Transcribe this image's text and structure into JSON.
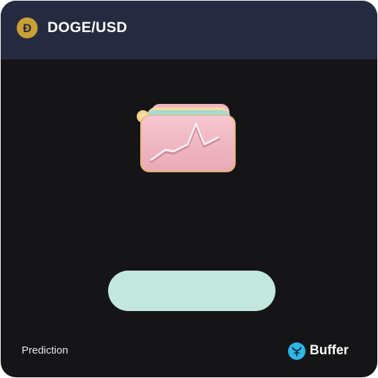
{
  "header": {
    "pair": "DOGE/USD",
    "coin_icon": "dogecoin-icon",
    "coin_color": "#c8a033"
  },
  "illustration": {
    "icon": "stacked-chart-cards-illustration",
    "card_color": "#f0b8c4"
  },
  "action": {
    "button_label": "",
    "button_color": "#c2e7df"
  },
  "footer": {
    "label": "Prediction",
    "brand_name": "Buffer",
    "brand_icon": "buffer-logo-icon",
    "brand_color": "#2fb6e6"
  },
  "colors": {
    "card_background": "#151517",
    "header_background": "#262a41"
  }
}
